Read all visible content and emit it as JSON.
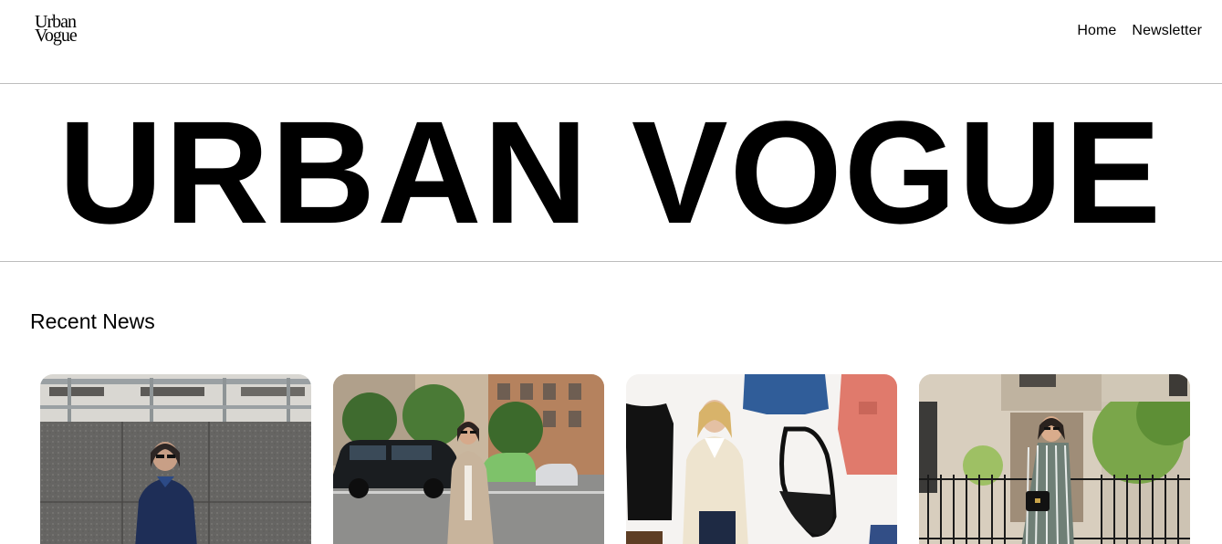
{
  "brand": {
    "logo_line1": "Urban",
    "logo_line2": "Vogue",
    "hero_title": "URBAN VOGUE"
  },
  "nav": {
    "items": [
      {
        "label": "Home"
      },
      {
        "label": "Newsletter"
      }
    ]
  },
  "recent_news": {
    "heading": "Recent News",
    "cards": [
      {
        "image": "woman-in-navy-sweater-by-stone-wall"
      },
      {
        "image": "woman-in-trench-coat-on-city-street"
      },
      {
        "image": "woman-in-cream-cardigan-fashion-collage"
      },
      {
        "image": "woman-in-striped-dress-by-brownstone"
      }
    ]
  },
  "colors": {
    "text": "#000000",
    "divider": "#bdbdbd",
    "background": "#ffffff"
  }
}
